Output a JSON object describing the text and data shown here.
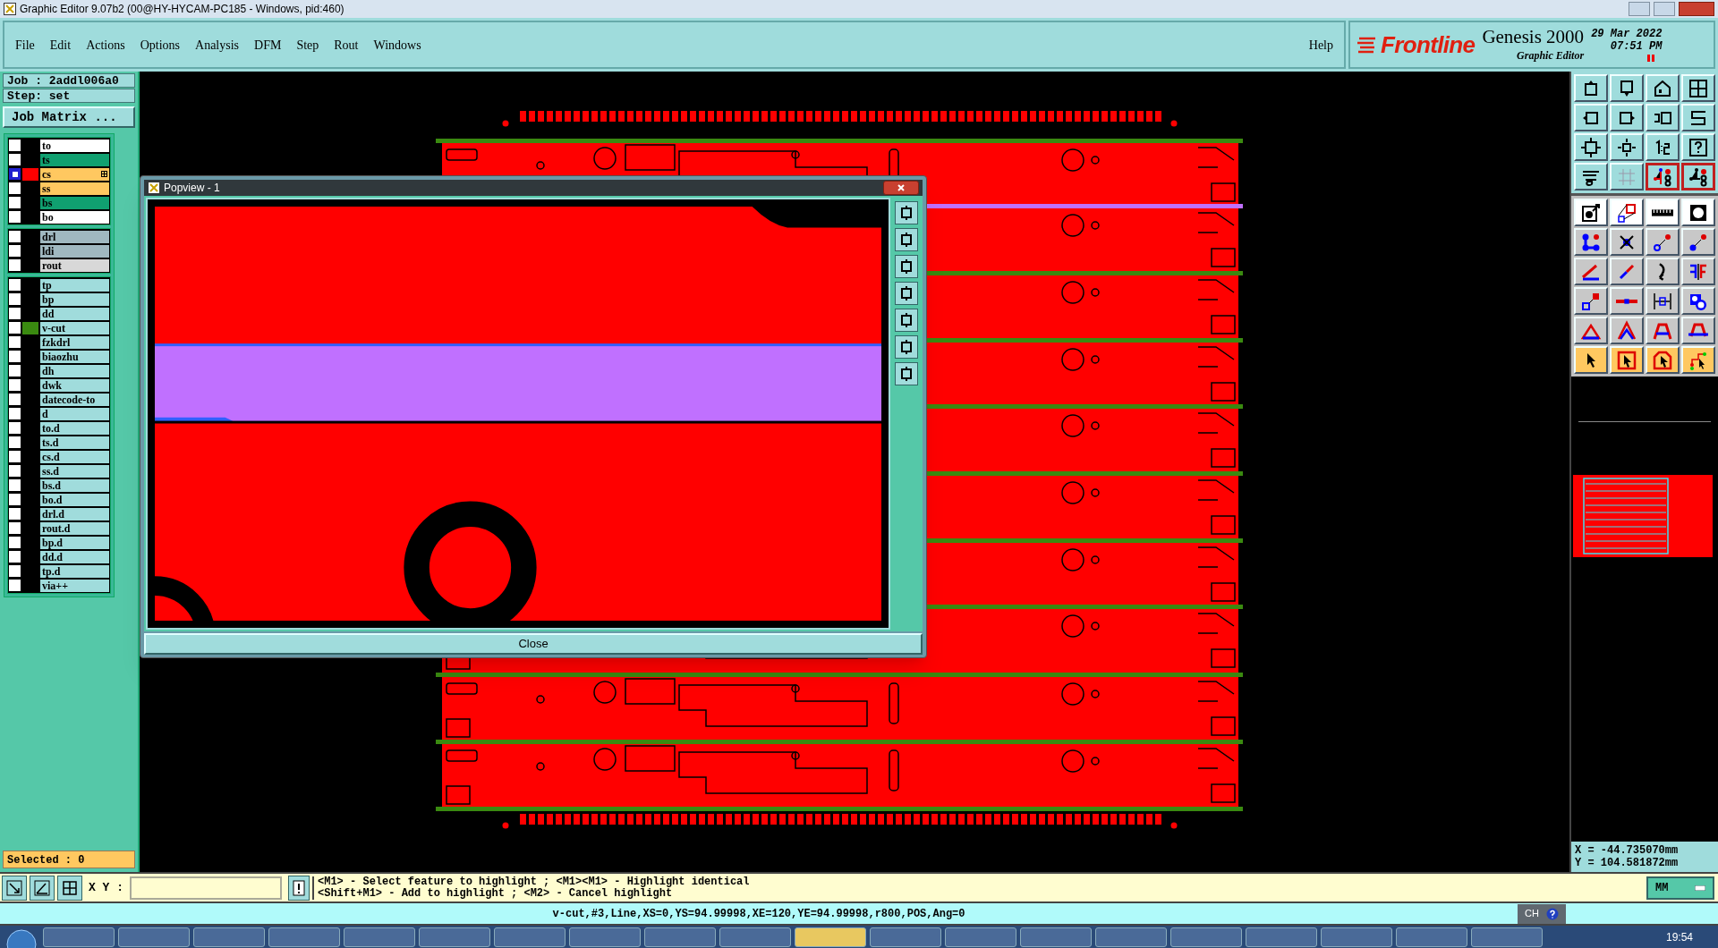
{
  "window": {
    "title": "Graphic Editor 9.07b2 (00@HY-HYCAM-PC185 - Windows, pid:460)"
  },
  "menu": [
    "File",
    "Edit",
    "Actions",
    "Options",
    "Analysis",
    "DFM",
    "Step",
    "Rout",
    "Windows"
  ],
  "help": "Help",
  "brand": {
    "logo": "Frontline",
    "product": "Genesis 2000",
    "subtitle": "Graphic Editor",
    "date": "29 Mar 2022",
    "time": "07:51 PM"
  },
  "job": "Job : 2addl006a0",
  "step": "Step: set",
  "job_matrix": "Job Matrix ...",
  "layer_groups": [
    [
      {
        "name": "to",
        "color": "#ffffff",
        "work": false
      },
      {
        "name": "ts",
        "color": "#10a070",
        "work": false
      },
      {
        "name": "cs",
        "color": "#ffc860",
        "work": true,
        "swatch": {
          "color": "#ff0000"
        }
      },
      {
        "name": "ss",
        "color": "#ffc860",
        "work": false
      },
      {
        "name": "bs",
        "color": "#10a070",
        "work": false
      },
      {
        "name": "bo",
        "color": "#ffffff",
        "work": false
      }
    ],
    [
      {
        "name": "drl",
        "color": "#a0b8c0",
        "work": false
      },
      {
        "name": "ldi",
        "color": "#a0b8c0",
        "work": false
      },
      {
        "name": "rout",
        "color": "#d8d8d8",
        "work": false
      }
    ],
    [
      {
        "name": "tp",
        "color": "#a0dcdc",
        "work": false
      },
      {
        "name": "bp",
        "color": "#a0dcdc",
        "work": false
      },
      {
        "name": "dd",
        "color": "#a0dcdc",
        "work": false
      },
      {
        "name": "v-cut",
        "color": "#a0dcdc",
        "work": false,
        "swatch": {
          "color": "#3a8a10"
        }
      },
      {
        "name": "fzkdrl",
        "color": "#a0dcdc",
        "work": false
      },
      {
        "name": "biaozhu",
        "color": "#a0dcdc",
        "work": false
      },
      {
        "name": "dh",
        "color": "#a0dcdc",
        "work": false
      },
      {
        "name": "dwk",
        "color": "#a0dcdc",
        "work": false
      },
      {
        "name": "datecode-to",
        "color": "#a0dcdc",
        "work": false
      },
      {
        "name": "d",
        "color": "#a0dcdc",
        "work": false
      },
      {
        "name": "to.d",
        "color": "#a0dcdc",
        "work": false
      },
      {
        "name": "ts.d",
        "color": "#a0dcdc",
        "work": false
      },
      {
        "name": "cs.d",
        "color": "#a0dcdc",
        "work": false
      },
      {
        "name": "ss.d",
        "color": "#a0dcdc",
        "work": false
      },
      {
        "name": "bs.d",
        "color": "#a0dcdc",
        "work": false
      },
      {
        "name": "bo.d",
        "color": "#a0dcdc",
        "work": false
      },
      {
        "name": "drl.d",
        "color": "#a0dcdc",
        "work": false
      },
      {
        "name": "rout.d",
        "color": "#a0dcdc",
        "work": false
      },
      {
        "name": "bp.d",
        "color": "#a0dcdc",
        "work": false
      },
      {
        "name": "dd.d",
        "color": "#a0dcdc",
        "work": false
      },
      {
        "name": "tp.d",
        "color": "#a0dcdc",
        "work": false
      },
      {
        "name": "via++",
        "color": "#a0dcdc",
        "work": false
      }
    ]
  ],
  "selected_count": "Selected : 0",
  "view_toggles": [
    {
      "on": true
    },
    {
      "on": true
    }
  ],
  "popup": {
    "title": "Popview - 1",
    "close": "Close"
  },
  "coordinates": {
    "x": "X = -44.735070mm",
    "y": "Y = 104.581872mm"
  },
  "xy_label": "X Y :",
  "hints": [
    "<M1> - Select feature to highlight ; <M1><M1> - Highlight identical",
    "<Shift+M1> - Add to highlight ; <M2> - Cancel highlight"
  ],
  "units": "MM",
  "status": "v-cut,#3,Line,XS=0,YS=94.99998,XE=120,YE=94.99998,r800,POS,Ang=0",
  "ime": "CH",
  "clock": "19:54"
}
